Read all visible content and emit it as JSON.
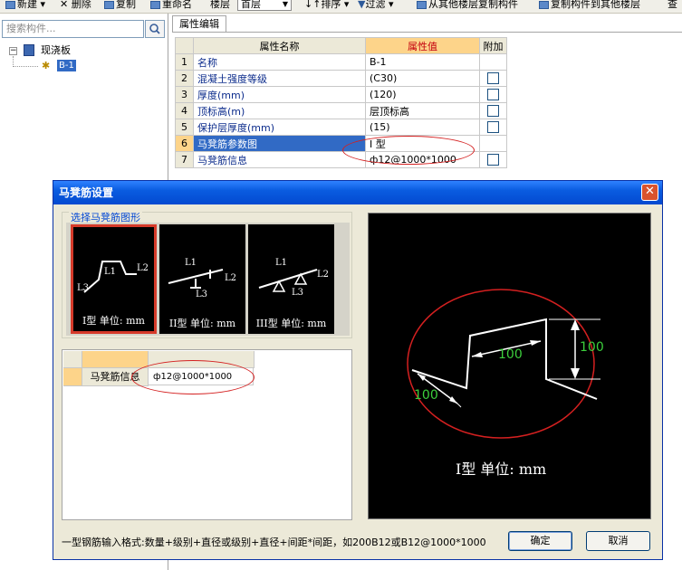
{
  "toolbar": {
    "items": [
      "新建",
      "删除",
      "复制",
      "重命名",
      "楼层",
      "排序",
      "过滤",
      "从其他楼层复制构件",
      "复制构件到其他楼层",
      "查"
    ],
    "floor_value": "首层"
  },
  "left_panel": {
    "search_placeholder": "搜索构件...",
    "tree": {
      "parent": "现浇板",
      "child": "B-1"
    }
  },
  "properties": {
    "tab": "属性编辑",
    "headers": [
      "属性名称",
      "属性值",
      "附加"
    ],
    "rows": [
      {
        "num": "1",
        "name": "名称",
        "value": "B-1",
        "check": false
      },
      {
        "num": "2",
        "name": "混凝土强度等级",
        "value": "(C30)",
        "check": true
      },
      {
        "num": "3",
        "name": "厚度(mm)",
        "value": "(120)",
        "check": true
      },
      {
        "num": "4",
        "name": "顶标高(m)",
        "value": "层顶标高",
        "check": true
      },
      {
        "num": "5",
        "name": "保护层厚度(mm)",
        "value": "(15)",
        "check": true
      },
      {
        "num": "6",
        "name": "马凳筋参数图",
        "value": "I 型",
        "check": false
      },
      {
        "num": "7",
        "name": "马凳筋信息",
        "value": "ф12@1000*1000",
        "check": true
      }
    ]
  },
  "dialog": {
    "title": "马凳筋设置",
    "close": "✕",
    "group_title": "选择马凳筋图形",
    "shapes": [
      {
        "caption": "I型 单位: mm",
        "labels": [
          "L1",
          "L2",
          "L3"
        ]
      },
      {
        "caption": "II型 单位: mm",
        "labels": [
          "L1",
          "L2",
          "L3"
        ]
      },
      {
        "caption": "III型 单位: mm",
        "labels": [
          "L1",
          "L2",
          "L3"
        ]
      }
    ],
    "info_label": "马凳筋信息",
    "info_value": "ф12@1000*1000",
    "preview": {
      "dim_left": "100",
      "dim_mid": "100",
      "dim_right": "100",
      "caption": "I型 单位: mm"
    },
    "format_hint": "一型钢筋输入格式:数量+级别+直径或级别+直径+间距*间距，如200B12或B12@1000*1000",
    "ok_label": "确定",
    "cancel_label": "取消"
  },
  "colors": {
    "title_bar": "#0a5ce0",
    "highlight_row": "#316ac5",
    "header_accent": "#fdd48a",
    "dim_green": "#3ccf3c",
    "annotation": "#d42020"
  }
}
